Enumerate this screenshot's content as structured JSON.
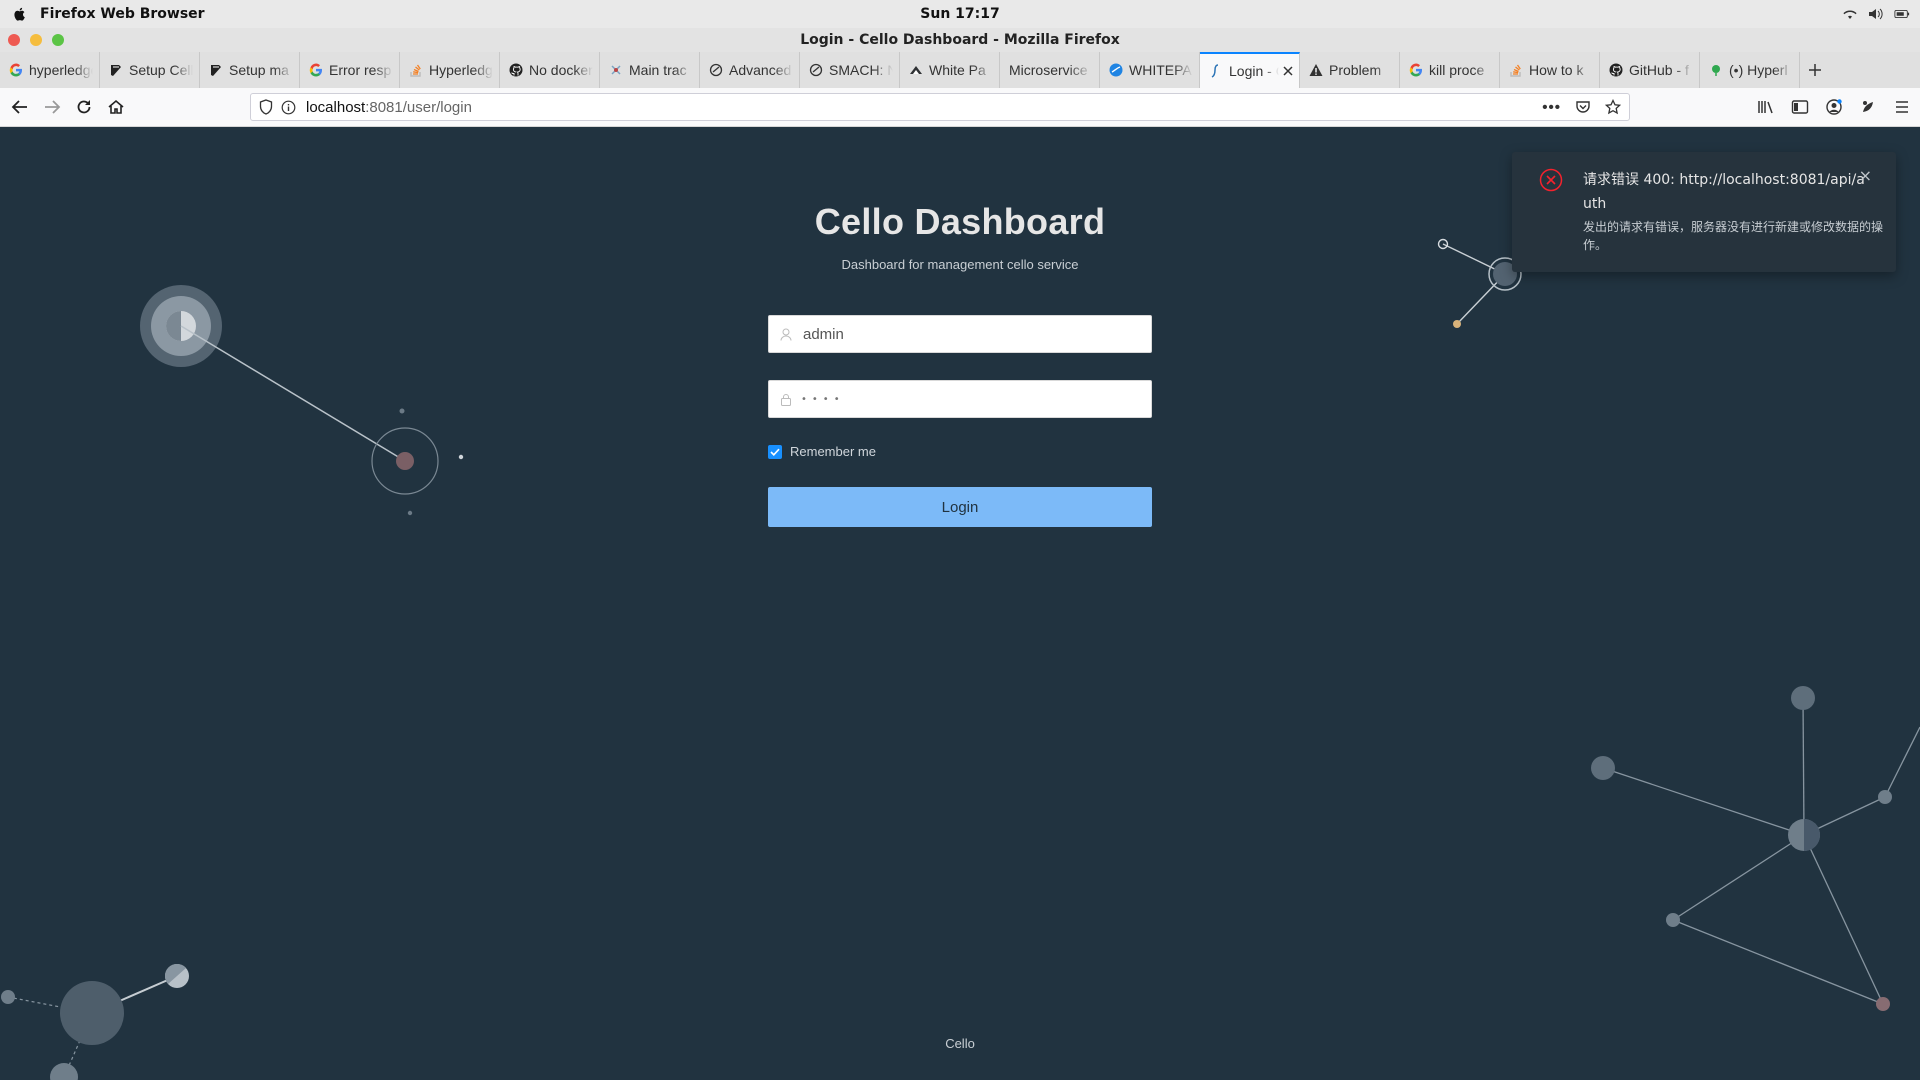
{
  "os": {
    "app_name": "Firefox Web Browser",
    "clock": "Sun 17:17"
  },
  "window": {
    "title": "Login - Cello Dashboard - Mozilla Firefox"
  },
  "tabs": [
    {
      "label": "hyperledger",
      "icon": "google-icon"
    },
    {
      "label": "Setup Cello",
      "icon": "book-icon"
    },
    {
      "label": "Setup ma",
      "icon": "book-icon"
    },
    {
      "label": "Error resp",
      "icon": "google-icon"
    },
    {
      "label": "Hyperledger",
      "icon": "stackoverflow-icon"
    },
    {
      "label": "No docker",
      "icon": "github-icon"
    },
    {
      "label": "Main trac",
      "icon": "trac-icon"
    },
    {
      "label": "Advanced",
      "icon": "docs-icon"
    },
    {
      "label": "SMACH: N",
      "icon": "docs-icon"
    },
    {
      "label": "White Pa",
      "icon": "hyperledger-icon"
    },
    {
      "label": "Microservice",
      "icon": ""
    },
    {
      "label": "WHITEPA",
      "icon": "blue-globe-icon"
    },
    {
      "label": "Login - C",
      "icon": "cello-icon",
      "active": true
    },
    {
      "label": "Problem",
      "icon": "warning-icon"
    },
    {
      "label": "kill proce",
      "icon": "google-icon"
    },
    {
      "label": "How to k",
      "icon": "stackoverflow-icon"
    },
    {
      "label": "GitHub - f",
      "icon": "github-icon"
    },
    {
      "label": "(•) Hyperl",
      "icon": "green-dot-icon"
    }
  ],
  "navbar": {
    "url_host": "localhost",
    "url_path": ":8081/user/login"
  },
  "login": {
    "title": "Cello Dashboard",
    "subtitle": "Dashboard for management cello service",
    "username_value": "admin",
    "username_placeholder": "admin",
    "password_value": "••••",
    "remember_label": "Remember me",
    "remember_checked": true,
    "login_button": "Login"
  },
  "footer": {
    "text": "Cello"
  },
  "notification": {
    "title": "请求错误 400: http://localhost:8081/api/auth",
    "description": "发出的请求有错误，服务器没有进行新建或修改数据的操作。",
    "close_label": "×",
    "error_color": "#f5222d"
  }
}
